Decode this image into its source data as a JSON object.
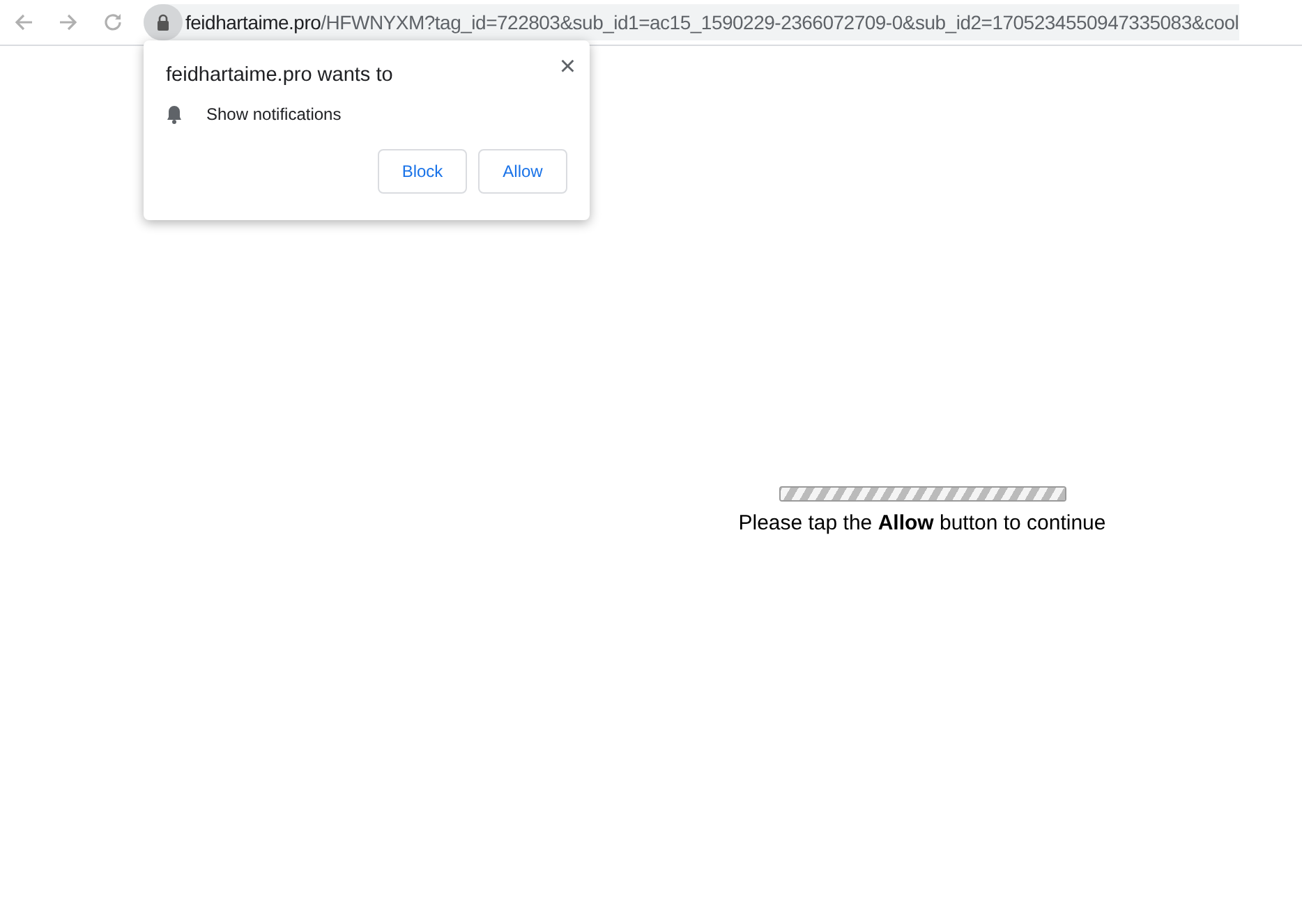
{
  "address_bar": {
    "domain": "feidhartaime.pro",
    "path": "/HFWNYXM?tag_id=722803&sub_id1=ac15_1590229-2366072709-0&sub_id2=1705234550947335083&cool"
  },
  "permission_popup": {
    "title": "feidhartaime.pro wants to",
    "close": "×",
    "permission": "Show notifications",
    "buttons": [
      "Block",
      "Allow"
    ]
  },
  "page": {
    "progress": {
      "level": 1
    },
    "message": "Please tap the **Allow** button to continue"
  }
}
